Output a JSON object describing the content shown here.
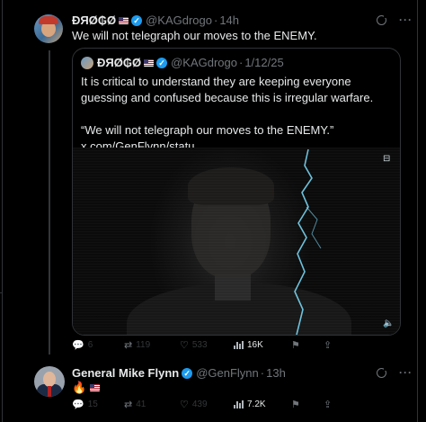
{
  "tweet": {
    "author_name": "ÐЯØ₲Ø",
    "handle": "@KAGdrogo",
    "time": "14h",
    "text": "We will not telegraph our moves to the ENEMY.",
    "quoted": {
      "author_name": "ÐЯØ₲Ø",
      "handle": "@KAGdrogo",
      "date": "1/12/25",
      "paragraph1": "It is critical to understand they are keeping everyone guessing and confused because this is irregular warfare.",
      "paragraph2": "“We will not telegraph our moves to the ENEMY.” x.com/GenFlynn/statu…"
    },
    "metrics": {
      "replies": "6",
      "reposts": "119",
      "likes": "533",
      "views": "16K"
    }
  },
  "reply": {
    "author_name": "General Mike Flynn",
    "handle": "@GenFlynn",
    "time": "13h",
    "text": "🔥",
    "metrics": {
      "replies": "15",
      "reposts": "41",
      "likes": "439",
      "views": "7.2K"
    }
  },
  "icons": {
    "verified": "verified-badge-icon",
    "flag": "us-flag-icon",
    "grok": "grok-icon",
    "more": "more-icon",
    "reply": "reply-icon",
    "repost": "repost-icon",
    "like": "heart-icon",
    "views": "views-chart-icon",
    "bookmark": "bookmark-icon",
    "share": "share-icon",
    "captions": "captions-icon",
    "mute": "volume-icon"
  },
  "colors": {
    "background": "#000000",
    "accent": "#1d9bf0",
    "muted": "#71767b",
    "text": "#e7e9ea",
    "lightning": "#7fe0ff"
  }
}
